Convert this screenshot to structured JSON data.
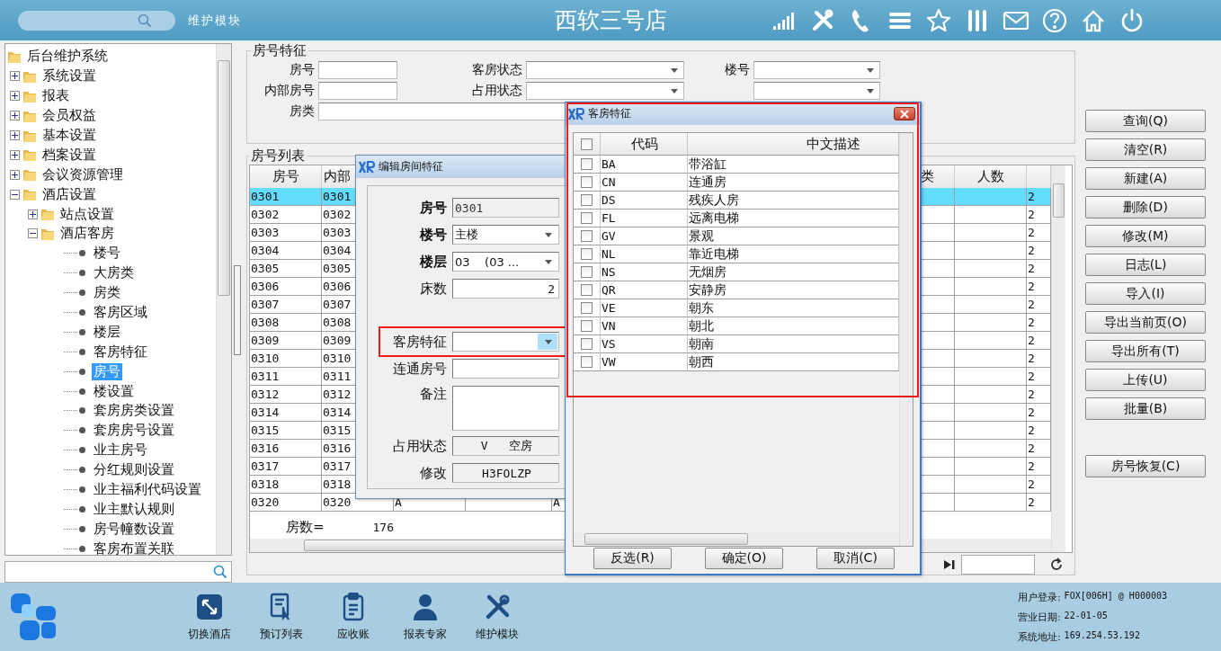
{
  "top_bar": {
    "module_label": "维护模块",
    "title": "西软三号店"
  },
  "tree": {
    "items": [
      {
        "kind": "root",
        "label": "后台维护系统",
        "children": [
          {
            "kind": "folder",
            "label": "系统设置",
            "expanded": false
          },
          {
            "kind": "folder",
            "label": "报表",
            "expanded": false
          },
          {
            "kind": "folder",
            "label": "会员权益",
            "expanded": false
          },
          {
            "kind": "folder",
            "label": "基本设置",
            "expanded": false
          },
          {
            "kind": "folder",
            "label": "档案设置",
            "expanded": false
          },
          {
            "kind": "folder",
            "label": "会议资源管理",
            "expanded": false
          },
          {
            "kind": "folder",
            "label": "酒店设置",
            "expanded": true,
            "children": [
              {
                "kind": "folder",
                "label": "站点设置",
                "expanded": false
              },
              {
                "kind": "folder",
                "label": "酒店客房",
                "expanded": true,
                "children": [
                  {
                    "kind": "leaf",
                    "label": "楼号",
                    "selected": false
                  },
                  {
                    "kind": "leaf",
                    "label": "大房类",
                    "selected": false
                  },
                  {
                    "kind": "leaf",
                    "label": "房类",
                    "selected": false
                  },
                  {
                    "kind": "leaf",
                    "label": "客房区域",
                    "selected": false
                  },
                  {
                    "kind": "leaf",
                    "label": "楼层",
                    "selected": false
                  },
                  {
                    "kind": "leaf",
                    "label": "客房特征",
                    "selected": false
                  },
                  {
                    "kind": "leaf",
                    "label": "房号",
                    "selected": true
                  },
                  {
                    "kind": "leaf",
                    "label": "楼设置",
                    "selected": false
                  },
                  {
                    "kind": "leaf",
                    "label": "套房房类设置",
                    "selected": false
                  },
                  {
                    "kind": "leaf",
                    "label": "套房房号设置",
                    "selected": false
                  },
                  {
                    "kind": "leaf",
                    "label": "业主房号",
                    "selected": false
                  },
                  {
                    "kind": "leaf",
                    "label": "分红规则设置",
                    "selected": false
                  },
                  {
                    "kind": "leaf",
                    "label": "业主福利代码设置",
                    "selected": false
                  },
                  {
                    "kind": "leaf",
                    "label": "业主默认规则",
                    "selected": false
                  },
                  {
                    "kind": "leaf",
                    "label": "房号幢数设置",
                    "selected": false
                  },
                  {
                    "kind": "leaf",
                    "label": "客房布置关联",
                    "selected": false
                  }
                ]
              }
            ]
          }
        ]
      }
    ]
  },
  "room_filter": {
    "title": "房号特征",
    "fields": [
      {
        "kind": "text",
        "label": "房号"
      },
      {
        "kind": "dropdown",
        "label": "客房状态"
      },
      {
        "kind": "dropdown",
        "label": "楼号"
      },
      {
        "kind": "text",
        "label": "内部房号"
      },
      {
        "kind": "dropdown",
        "label": "占用状态"
      },
      {
        "kind": "dropdown"
      },
      {
        "kind": "wide",
        "label": "房类"
      }
    ]
  },
  "room_list": {
    "title": "房号列表",
    "left_columns": [
      "房号",
      "内部"
    ],
    "right_columns": [
      "类",
      "人数"
    ],
    "rows": [
      {
        "room": "0301",
        "internal": "0301",
        "beds": "2",
        "selected": true
      },
      {
        "room": "0302",
        "internal": "0302",
        "beds": "2",
        "selected": false
      },
      {
        "room": "0303",
        "internal": "0303",
        "beds": "2",
        "selected": false
      },
      {
        "room": "0304",
        "internal": "0304",
        "beds": "2",
        "selected": false
      },
      {
        "room": "0305",
        "internal": "0305",
        "beds": "2",
        "selected": false
      },
      {
        "room": "0306",
        "internal": "0306",
        "beds": "2",
        "selected": false
      },
      {
        "room": "0307",
        "internal": "0307",
        "beds": "2",
        "selected": false
      },
      {
        "room": "0308",
        "internal": "0308",
        "beds": "2",
        "selected": false
      },
      {
        "room": "0309",
        "internal": "0309",
        "beds": "2",
        "selected": false
      },
      {
        "room": "0310",
        "internal": "0310",
        "beds": "2",
        "selected": false
      },
      {
        "room": "0311",
        "internal": "0311",
        "beds": "2",
        "selected": false
      },
      {
        "room": "0312",
        "internal": "0312",
        "beds": "2",
        "selected": false
      },
      {
        "room": "0314",
        "internal": "0314",
        "beds": "2",
        "selected": false
      },
      {
        "room": "0315",
        "internal": "0315",
        "beds": "2",
        "selected": false
      },
      {
        "room": "0316",
        "internal": "0316",
        "beds": "2",
        "selected": false
      },
      {
        "room": "0317",
        "internal": "0317",
        "beds": "2",
        "selected": false
      },
      {
        "room": "0318",
        "internal": "0318",
        "beds": "2",
        "selected": false
      },
      {
        "room": "0320",
        "internal": "0320",
        "column_3": "A",
        "column_5": "A",
        "beds": "2",
        "selected": false
      }
    ],
    "count_label": "房数=",
    "count": "176"
  },
  "actions": [
    "查询(Q)",
    "清空(R)",
    "新建(A)",
    "删除(D)",
    "修改(M)",
    "日志(L)",
    "导入(I)",
    "导出当前页(O)",
    "导出所有(T)",
    "上传(U)",
    "批量(B)"
  ],
  "restore_action": "房号恢复(C)",
  "edit_dialog": {
    "title": "编辑房间特征",
    "sections": [
      {
        "fields": [
          {
            "kind": "readonly",
            "label": "房号",
            "value": "0301",
            "emphasized": true,
            "highlighted": false
          },
          {
            "kind": "dropdown",
            "label": "楼号",
            "value": "主楼",
            "emphasized": true,
            "highlighted": false
          },
          {
            "kind": "dropdown",
            "label": "楼层",
            "value": "03    (03 ...",
            "emphasized": true,
            "highlighted": false
          },
          {
            "kind": "number",
            "label": "床数",
            "value": "2",
            "emphasized": false,
            "highlighted": false
          }
        ]
      },
      {
        "fields": [
          {
            "kind": "dropdown",
            "label": "客房特征",
            "emphasized": false,
            "highlighted": true
          },
          {
            "kind": "text",
            "label": "连通房号",
            "emphasized": false,
            "highlighted": false
          },
          {
            "kind": "textarea",
            "label": "备注",
            "emphasized": false,
            "highlighted": false
          },
          {
            "kind": "display",
            "label": "占用状态",
            "value": "V   空房",
            "emphasized": false,
            "highlighted": false
          },
          {
            "kind": "display",
            "label": "修改",
            "value": "H3FOLZP",
            "emphasized": false,
            "highlighted": false
          }
        ]
      }
    ]
  },
  "feature_dialog": {
    "title": "客房特征",
    "highlighted": true,
    "all_checked": false,
    "columns": [
      "代码",
      "中文描述"
    ],
    "rows": [
      {
        "code": "BA",
        "name": "带浴缸",
        "checked": false
      },
      {
        "code": "CN",
        "name": "连通房",
        "checked": false
      },
      {
        "code": "DS",
        "name": "残疾人房",
        "checked": false
      },
      {
        "code": "FL",
        "name": "远离电梯",
        "checked": false
      },
      {
        "code": "GV",
        "name": "景观",
        "checked": false
      },
      {
        "code": "NL",
        "name": "靠近电梯",
        "checked": false
      },
      {
        "code": "NS",
        "name": "无烟房",
        "checked": false
      },
      {
        "code": "QR",
        "name": "安静房",
        "checked": false
      },
      {
        "code": "VE",
        "name": "朝东",
        "checked": false
      },
      {
        "code": "VN",
        "name": "朝北",
        "checked": false
      },
      {
        "code": "VS",
        "name": "朝南",
        "checked": false
      },
      {
        "code": "VW",
        "name": "朝西",
        "checked": false
      }
    ],
    "buttons": [
      "反选(R)",
      "确定(O)",
      "取消(C)"
    ]
  },
  "bottom_bar": {
    "apps": [
      {
        "kind": "switch",
        "label": "切换酒店"
      },
      {
        "kind": "booking",
        "label": "预订列表"
      },
      {
        "kind": "receivable",
        "label": "应收账"
      },
      {
        "kind": "expert",
        "label": "报表专家"
      },
      {
        "kind": "tools",
        "label": "维护模块"
      }
    ],
    "info": [
      {
        "label": "用户登录:",
        "value": "FOX[006H] @ H000003"
      },
      {
        "label": "营业日期:",
        "value": "22-01-05"
      },
      {
        "label": "系统地址:",
        "value": "169.254.53.192"
      }
    ]
  }
}
